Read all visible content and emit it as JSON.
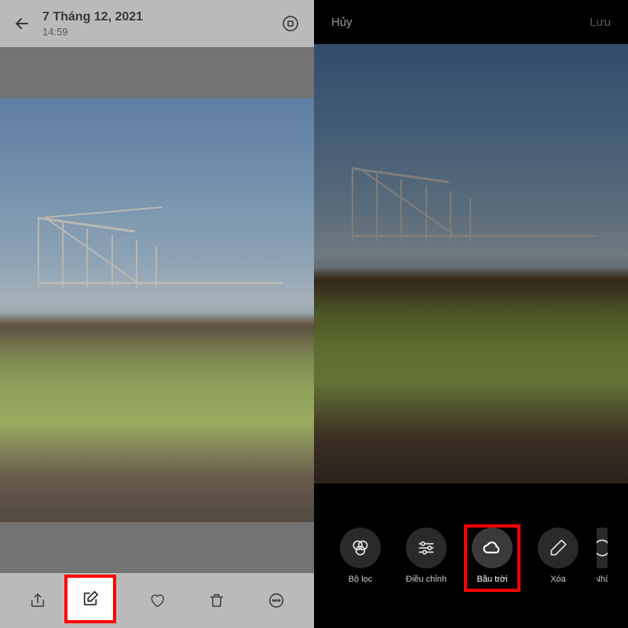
{
  "left": {
    "date": "7 Tháng 12, 2021",
    "time": "14:59",
    "toolbar": {
      "share": "share-icon",
      "edit": "edit-icon",
      "favorite": "heart-icon",
      "delete": "trash-icon",
      "more": "more-icon"
    }
  },
  "right": {
    "cancel": "Hủy",
    "save": "Lưu",
    "tools": [
      {
        "label": "Bộ lọc",
        "icon": "filter-icon"
      },
      {
        "label": "Điều chỉnh",
        "icon": "adjust-icon"
      },
      {
        "label": "Bầu trời",
        "icon": "cloud-icon"
      },
      {
        "label": "Xóa",
        "icon": "eraser-icon"
      },
      {
        "label": "Nhã",
        "icon": "sticker-icon"
      }
    ]
  }
}
